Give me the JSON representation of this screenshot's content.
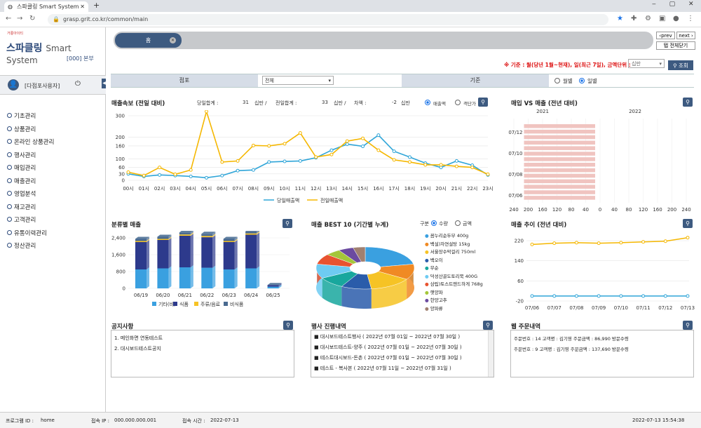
{
  "browser": {
    "tab_title": "스파클링 Smart System",
    "url": "grasp.grit.co.kr/common/main"
  },
  "brand": {
    "logo_text": "거룡아이티",
    "title": "스파클링",
    "subtitle": "Smart System",
    "branch": "[000] 본부",
    "user": "[다점포사용자]"
  },
  "menu": [
    "기초관리",
    "상품관리",
    "온라인 상품관리",
    "행사관리",
    "매입관리",
    "매출관리",
    "영업분석",
    "재고관리",
    "고객관리",
    "유통이력관리",
    "정산관리"
  ],
  "top": {
    "tab_label": "홈",
    "prev": "‹prev",
    "next": "next ›",
    "close_all": "탭 전체닫기"
  },
  "criteria": {
    "text": "※ 기준 : 월(당년 1월~현재), 일(최근 7일), 금액단위 :",
    "unit": "십만",
    "search": "조회"
  },
  "filter": {
    "store_label": "점포",
    "store_value": "전체",
    "basis_label": "기준",
    "monthly": "월별",
    "daily": "일별"
  },
  "sales": {
    "title": "매출속보 (전일 대비)",
    "today_label": "당일합계 :",
    "today_value": "31",
    "unit1": "십만 /",
    "yest_label": "전일합계 :",
    "yest_value": "33",
    "unit2": "십만 /",
    "diff_label": "차액 :",
    "diff_value": "-2",
    "unit3": "십만",
    "opt1": "매출액",
    "opt2": "객단가",
    "legend_a": "당일매출액",
    "legend_b": "전일매출액"
  },
  "buysell": {
    "title": "매입 VS 매출 (전년 대비)",
    "y2021": "2021",
    "y2022": "2022",
    "legend_a": "매입",
    "legend_b": "매출"
  },
  "category": {
    "title": "분류별 매출",
    "legend": [
      "기타(비)",
      "식품",
      "주류/음료",
      "비식품"
    ]
  },
  "best": {
    "title": "매출 BEST 10 (기간별 누계)",
    "gubun": "구분",
    "opt1": "수량",
    "opt2": "금액",
    "items": [
      "꼼누리순두부 400g",
      "백설)자연설탕 15kg",
      "서울장수막걸리 750ml",
      "백오이",
      "무순",
      "덕성산골도토리묵 400G",
      "삼립)토스트앤드하게 768g",
      "햇양파",
      "한양고추",
      "양파류"
    ],
    "colors": [
      "#3aa0e0",
      "#f08a24",
      "#f6c325",
      "#2a5caa",
      "#18a79d",
      "#6ecbf2",
      "#e8532f",
      "#a4c639",
      "#6b4aa0",
      "#a08070"
    ]
  },
  "trend": {
    "title": "매출 추이 (전년 대비)",
    "legend_a": "2022",
    "legend_b": "2021"
  },
  "notice": {
    "title": "공지사항",
    "items": [
      "1. 메인화면 연동테스트",
      "2. 대시보드테스트공지"
    ]
  },
  "events": {
    "title": "행사 진행내역",
    "items": [
      "■ 대시보드테스트행사 ( 2022년 07월 01일 ~ 2022년 07월 30일 )",
      "■ 대시보드테스트-양주 ( 2022년 07월 01일 ~ 2022년 07월 30일 )",
      "■ 테스트대시보드-돈촌 ( 2022년 07월 01일 ~ 2022년 07월 30일 )",
      "■ 테스트 - 복사본 ( 2022년 07월 11일 ~ 2022년 07월 31일 )"
    ]
  },
  "orders": {
    "title": "웹 주문내역",
    "items": [
      "주문번호 : 14  고객명 : 김기영  주문금액 : 86,990 방문수령",
      "주문번호 : 9  고객명 : 김기영  주문금액 : 137,690 방문수령"
    ]
  },
  "status": {
    "program_label": "프로그램 ID :",
    "program": "home",
    "ip_label": "접속 IP :",
    "ip": "000.000.000.001",
    "time_label": "접속 시간 :",
    "time": "2022-07-13",
    "clock": "2022-07-13 15:54:38"
  },
  "chart_data": [
    {
      "type": "line",
      "title": "매출속보 (전일 대비)",
      "categories": [
        "00시",
        "01시",
        "02시",
        "03시",
        "04시",
        "05시",
        "06시",
        "07시",
        "08시",
        "09시",
        "10시",
        "11시",
        "12시",
        "13시",
        "14시",
        "15시",
        "16시",
        "17시",
        "18시",
        "19시",
        "20시",
        "21시",
        "22시",
        "23시"
      ],
      "ylim": [
        0,
        300
      ],
      "yticks": [
        0,
        30,
        60,
        100,
        160,
        200,
        300
      ],
      "series": [
        {
          "name": "당일매출액",
          "color": "#2fa5d8",
          "values": [
            30,
            18,
            25,
            22,
            18,
            12,
            22,
            45,
            48,
            85,
            88,
            90,
            105,
            140,
            168,
            158,
            210,
            135,
            108,
            80,
            60,
            90,
            70,
            25
          ]
        },
        {
          "name": "전일매출액",
          "color": "#f5b700",
          "values": [
            38,
            22,
            60,
            28,
            48,
            320,
            85,
            90,
            162,
            160,
            170,
            220,
            108,
            120,
            182,
            195,
            140,
            95,
            85,
            72,
            72,
            65,
            60,
            28
          ]
        }
      ]
    },
    {
      "type": "bar",
      "title": "매입 VS 매출 (전년 대비)",
      "orientation": "horizontal",
      "xlim": [
        -240,
        240
      ],
      "xticks": [
        240,
        200,
        160,
        120,
        80,
        40,
        0,
        40,
        80,
        120,
        160,
        200,
        240
      ],
      "categories": [
        "07/06",
        "07/08",
        "07/10",
        "07/12"
      ],
      "series": [
        {
          "name": "매입",
          "color": "#3d5a80",
          "values": [
            0,
            0,
            0,
            0
          ]
        },
        {
          "name": "매출",
          "color": "#f0c4c0",
          "values": [
            210,
            210,
            210,
            210
          ]
        }
      ]
    },
    {
      "type": "bar",
      "title": "분류별 매출",
      "stacked": true,
      "categories": [
        "06/19",
        "06/20",
        "06/21",
        "06/22",
        "06/23",
        "06/24",
        "06/25"
      ],
      "ylim": [
        0,
        2400
      ],
      "yticks": [
        0,
        800,
        1600,
        2400
      ],
      "series": [
        {
          "name": "기타(비)",
          "color": "#3aa0e0",
          "values": [
            900,
            950,
            1000,
            980,
            900,
            950,
            80
          ]
        },
        {
          "name": "식품",
          "color": "#2d3a8c",
          "values": [
            1300,
            1350,
            1500,
            1450,
            1300,
            1600,
            80
          ]
        },
        {
          "name": "주류/음료",
          "color": "#f6c325",
          "values": [
            50,
            50,
            60,
            60,
            50,
            60,
            0
          ]
        },
        {
          "name": "비식품",
          "color": "#4a6a90",
          "values": [
            100,
            100,
            100,
            100,
            100,
            100,
            0
          ]
        }
      ]
    },
    {
      "type": "pie",
      "title": "매출 BEST 10 (기간별 누계)",
      "categories": [
        "꼼누리순두부 400g",
        "백설)자연설탕 15kg",
        "서울장수막걸리 750ml",
        "백오이",
        "무순",
        "덕성산골도토리묵 400G",
        "삼립)토스트앤드하게 768g",
        "햇양파",
        "한양고추",
        "양파류"
      ],
      "values": [
        22,
        12,
        14,
        10,
        9,
        11,
        8,
        5,
        5,
        4
      ]
    },
    {
      "type": "line",
      "title": "매출 추이 (전년 대비)",
      "categories": [
        "07/06",
        "07/07",
        "07/08",
        "07/09",
        "07/10",
        "07/11",
        "07/12",
        "07/13"
      ],
      "ylim": [
        -20,
        220
      ],
      "yticks": [
        -20,
        60,
        140,
        220
      ],
      "series": [
        {
          "name": "2022",
          "color": "#2fa5d8",
          "values": [
            0,
            0,
            0,
            0,
            0,
            0,
            0,
            0
          ]
        },
        {
          "name": "2021",
          "color": "#f5b700",
          "values": [
            205,
            210,
            212,
            210,
            212,
            215,
            218,
            232
          ]
        }
      ]
    }
  ]
}
